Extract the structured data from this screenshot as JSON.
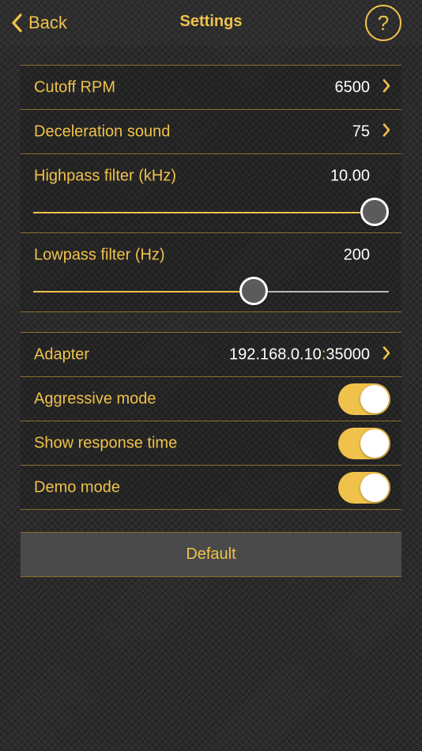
{
  "navbar": {
    "back_label": "Back",
    "title": "Settings",
    "help_label": "?"
  },
  "settings_group_1": {
    "cutoff_rpm": {
      "label": "Cutoff RPM",
      "value": "6500"
    },
    "deceleration_sound": {
      "label": "Deceleration sound",
      "value": "75"
    },
    "highpass_filter": {
      "label": "Highpass filter (kHz)",
      "value": "10.00",
      "level": 1.0
    },
    "lowpass_filter": {
      "label": "Lowpass filter (Hz)",
      "value": "200",
      "level": 0.63
    }
  },
  "settings_group_2": {
    "adapter": {
      "label": "Adapter",
      "ip": "192.168.0.10",
      "separator": ":",
      "port": "35000"
    },
    "aggressive_mode": {
      "label": "Aggressive mode",
      "on": true
    },
    "show_response_time": {
      "label": "Show response time",
      "on": true
    },
    "demo_mode": {
      "label": "Demo mode",
      "on": true
    }
  },
  "default_button": {
    "label": "Default"
  },
  "colors": {
    "accent": "#f0c24b",
    "value_text": "#ffffff",
    "background": "#2b2b2b",
    "separator": "#8a7030",
    "button_bg": "#4a4a4a"
  },
  "icons": {
    "back": "chevron-left-icon",
    "disclosure": "chevron-right-icon",
    "help": "question-circle-icon"
  }
}
